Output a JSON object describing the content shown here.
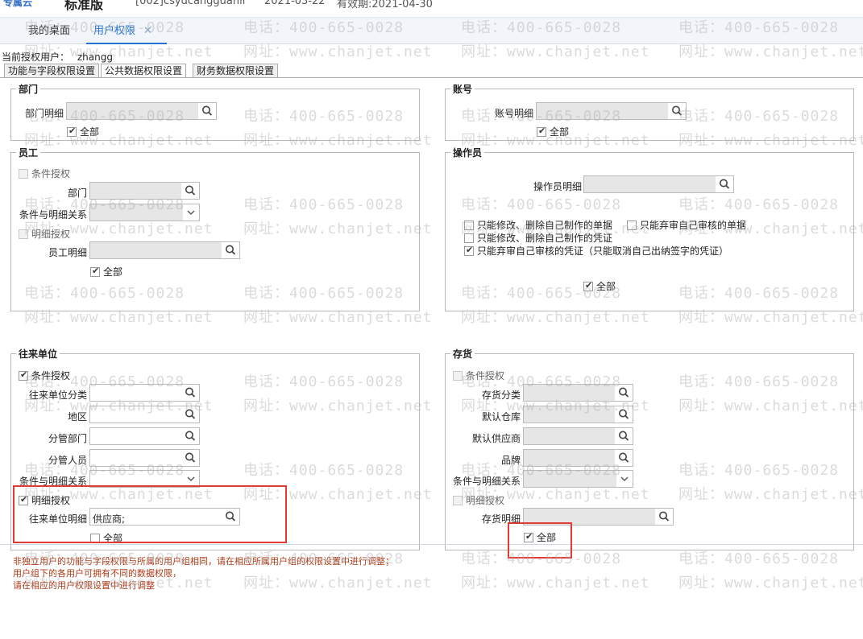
{
  "header": {
    "brand": "专属云",
    "edition": "标准版",
    "account": "[002]csydcangguanli",
    "date": "2021-03-22",
    "valid": "有效期:2021-04-30"
  },
  "tabs": {
    "desktop": "我的桌面",
    "user_rights": "用户权限",
    "close": "✕"
  },
  "current_user": {
    "label": "当前授权用户：",
    "name": "zhangg"
  },
  "subtabs": {
    "func": "功能与字段权限设置",
    "public": "公共数据权限设置",
    "finance": "财务数据权限设置"
  },
  "watermark": {
    "phone": "电话：400-665-0028",
    "site": "网址：www.chanjet.net"
  },
  "dept": {
    "title": "部门",
    "detail_label": "部门明细",
    "detail_value": "",
    "all_label": "全部",
    "all_checked": true
  },
  "account": {
    "title": "账号",
    "detail_label": "账号明细",
    "detail_value": "",
    "all_label": "全部",
    "all_checked": true
  },
  "employee": {
    "title": "员工",
    "cond_label": "条件授权",
    "dept_label": "部门",
    "relation_label": "条件与明细关系",
    "detail_auth_label": "明细授权",
    "detail_label": "员工明细",
    "all_label": "全部",
    "all_checked": true
  },
  "operator": {
    "title": "操作员",
    "detail_label": "操作员明细",
    "opt1": "只能修改、删除自己制作的单据",
    "opt2": "只能弃审自己审核的单据",
    "opt3": "只能修改、删除自己制作的凭证",
    "opt4": "只能弃审自己审核的凭证（只能取消自己出纳签字的凭证）",
    "opt4_checked": true,
    "all_label": "全部",
    "all_checked": true
  },
  "partner": {
    "title": "往来单位",
    "cond_label": "条件授权",
    "cond_checked": true,
    "category_label": "往来单位分类",
    "region_label": "地区",
    "dept_label": "分管部门",
    "staff_label": "分管人员",
    "relation_label": "条件与明细关系",
    "detail_auth_label": "明细授权",
    "detail_auth_checked": true,
    "detail_label": "往来单位明细",
    "detail_value": "供应商;",
    "all_label": "全部",
    "all_checked": false
  },
  "inventory": {
    "title": "存货",
    "cond_label": "条件授权",
    "category_label": "存货分类",
    "warehouse_label": "默认仓库",
    "supplier_label": "默认供应商",
    "brand_label": "品牌",
    "relation_label": "条件与明细关系",
    "detail_auth_label": "明细授权",
    "detail_label": "存货明细",
    "all_label": "全部",
    "all_checked": true
  },
  "notes": {
    "line1": "非独立用户的功能与字段权限与所属的用户组相同，请在相应所属用户组的权限设置中进行调整；",
    "line2": "用户组下的各用户可拥有不同的数据权限，",
    "line3": "请在相应的用户权限设置中进行调整"
  },
  "colors": {
    "accent": "#2574d4",
    "highlight_box": "#e53935",
    "note_text": "#b03a16"
  }
}
